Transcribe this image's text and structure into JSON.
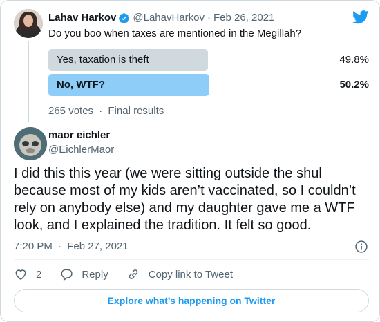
{
  "parent_tweet": {
    "author_name": "Lahav Harkov",
    "handle": "@LahavHarkov",
    "separator": "·",
    "date": "Feb 26, 2021",
    "text": "Do you boo when taxes are mentioned in the Megillah?"
  },
  "poll": {
    "options": [
      {
        "label": "Yes, taxation is theft",
        "percent": "49.8%",
        "fraction": 0.498,
        "winner": false
      },
      {
        "label": "No, WTF?",
        "percent": "50.2%",
        "fraction": 0.502,
        "winner": true
      }
    ],
    "votes": "265 votes",
    "separator": "·",
    "status": "Final results",
    "colors": {
      "winner": "#8ecdf8",
      "other": "#cfd9de"
    }
  },
  "reply_tweet": {
    "author_name": "maor eichler",
    "handle": "@EichlerMaor",
    "text": "I did this this year (we were sitting outside the shul because most of my kids aren’t vaccinated, so I couldn’t rely on anybody else) and my daughter gave me a WTF look, and I explained the tradition. It felt so good.",
    "time": "7:20 PM",
    "separator": "·",
    "date": "Feb 27, 2021"
  },
  "actions": {
    "like_count": "2",
    "reply_label": "Reply",
    "copy_link_label": "Copy link to Tweet"
  },
  "explore_label": "Explore what’s happening on Twitter",
  "icons": [
    "verified-badge-icon",
    "twitter-bird-icon",
    "info-icon",
    "heart-icon",
    "reply-bubble-icon",
    "link-icon"
  ],
  "colors": {
    "accent": "#1d9bf0",
    "text": "#0f1419",
    "muted": "#536471",
    "border": "#cfd9de"
  }
}
